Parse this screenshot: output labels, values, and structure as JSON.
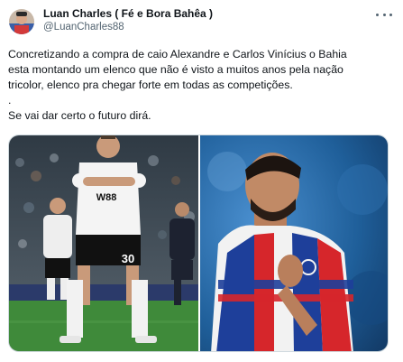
{
  "author": {
    "display_name": "Luan Charles ( Fé e Bora Bahêa )",
    "handle": "@LuanCharles88"
  },
  "tweet": {
    "lines": [
      "Concretizando a compra de caio Alexandre e Carlos Vinícius o Bahia",
      "esta montando um elenco que não é visto a muitos anos pela nação",
      "tricolor, elenco pra chegar forte em todas as competições.",
      ".",
      "Se vai dar certo o futuro dirá."
    ]
  },
  "media": {
    "left_photo": {
      "jersey_number": "30",
      "sponsor": "W88",
      "colors": {
        "shirt": "#f4f4f4",
        "shorts": "#111111",
        "grass": "#3f8a3a",
        "crowd": "#4a5a66"
      }
    },
    "right_photo": {
      "colors": {
        "background": "#1f5f9a",
        "shirt_red": "#d6262b",
        "shirt_blue": "#1e3f9a",
        "shirt_white": "#f2f2f2"
      }
    }
  },
  "icons": {
    "more": "more-horizontal-icon",
    "avatar": "user-avatar"
  }
}
